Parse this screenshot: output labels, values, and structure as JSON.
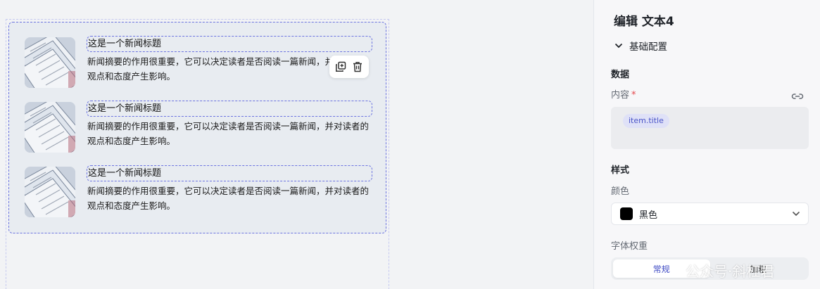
{
  "canvas": {
    "news_items": [
      {
        "title": "这是一个新闻标题",
        "summary": "新闻摘要的作用很重要，它可以决定读者是否阅读一篇新闻，并对读者的观点和态度产生影响。"
      },
      {
        "title": "这是一个新闻标题",
        "summary": "新闻摘要的作用很重要，它可以决定读者是否阅读一篇新闻，并对读者的观点和态度产生影响。"
      },
      {
        "title": "这是一个新闻标题",
        "summary": "新闻摘要的作用很重要，它可以决定读者是否阅读一篇新闻，并对读者的观点和态度产生影响。"
      }
    ],
    "toolbar": {
      "copy_icon": "copy-icon",
      "delete_icon": "trash-icon"
    }
  },
  "panel": {
    "title": "编辑 文本4",
    "section": "基础配置",
    "data_heading": "数据",
    "content_label": "内容",
    "required_mark": "*",
    "content_token": "item.title",
    "style_heading": "样式",
    "color_label": "颜色",
    "color_value": "黑色",
    "color_swatch": "#000000",
    "weight_label": "字体权重",
    "weight_options": [
      "常规",
      "加粗"
    ],
    "weight_selected": "常规"
  },
  "watermark": "公众号·斜杠君",
  "colors": {
    "accent": "#6b73e0",
    "token_text": "#4a54c8",
    "required": "#e5484d"
  }
}
